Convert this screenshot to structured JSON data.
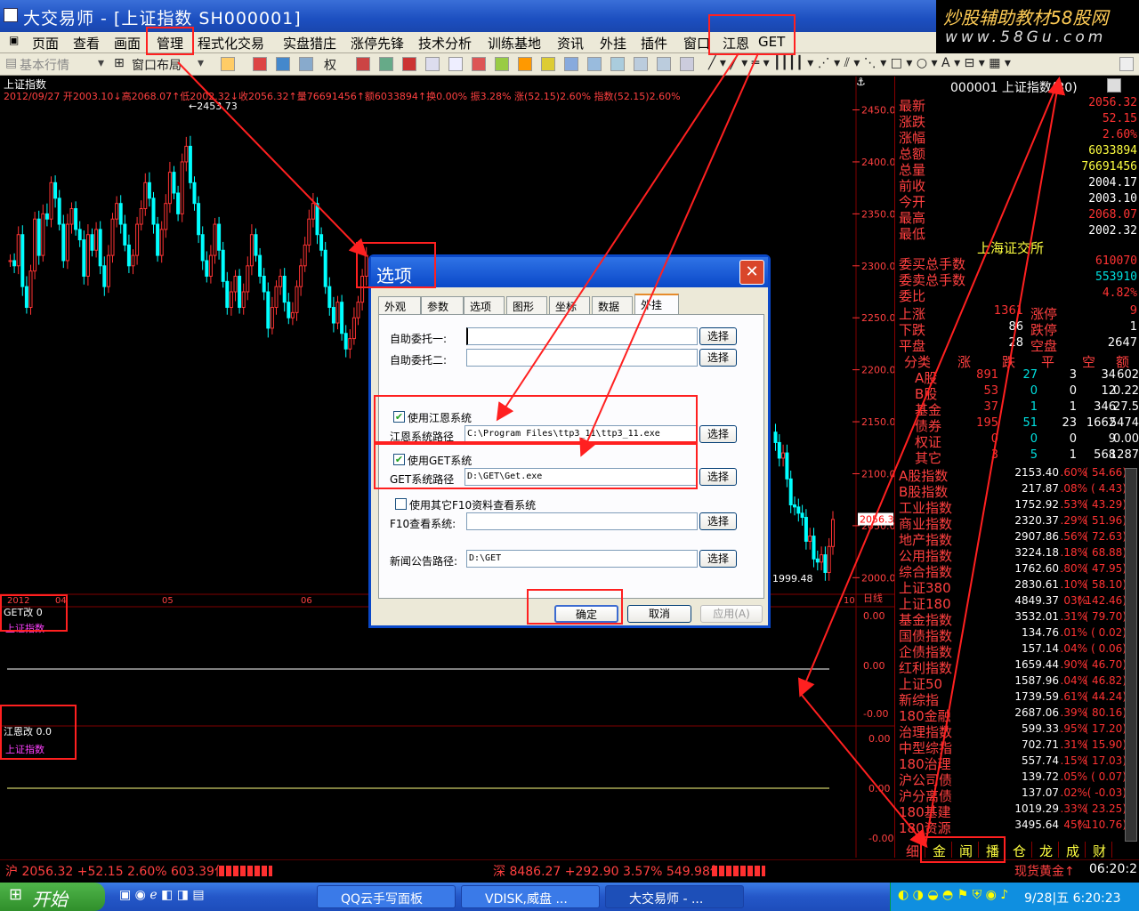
{
  "window": {
    "title": "大交易师 - [上证指数 SH000001]"
  },
  "watermark": {
    "line1": "炒股辅助教材58股网",
    "line2": "www.58Gu.com"
  },
  "menu": [
    "页面",
    "查看",
    "画面",
    "管理",
    "程式化交易",
    "实盘猎庄",
    "涨停先锋",
    "技术分析",
    "训练基地",
    "资讯",
    "外挂",
    "插件",
    "窗口",
    "江恩",
    "GET"
  ],
  "toolbar": {
    "market_label": "基本行情",
    "layout_label": "窗口布局",
    "rights_label": "权"
  },
  "chart_header": {
    "name": "上证指数",
    "info": "2012/09/27 开2003.10↓高2068.07↑低2002.32↓收2056.32↑量76691456↑额6033894↑换0.00% 振3.28% 涨(52.15)2.60% 指数(52.15)2.60%"
  },
  "chart_data": {
    "type": "candlestick",
    "title": "上证指数",
    "y_ticks": [
      2450.0,
      2400.0,
      2350.0,
      2300.0,
      2250.0,
      2200.0,
      2150.0,
      2100.0,
      2050.0,
      2000.0
    ],
    "ylim": [
      1990,
      2465
    ],
    "x_labels": [
      "2012",
      "04",
      "05",
      "06",
      "10"
    ],
    "annotations": {
      "high": "2453.73",
      "low": "1999.48",
      "current": "2056.3"
    },
    "segment_visible_left": {
      "start": 2320,
      "points": [
        -15,
        -20,
        10,
        -40,
        -60,
        -25,
        25,
        -10,
        30,
        25,
        60,
        45,
        20,
        -15,
        20,
        35,
        15,
        5,
        -30,
        10,
        -5,
        15,
        -20,
        -40,
        -10,
        25,
        40,
        20,
        0,
        -20,
        -10,
        20,
        35,
        60,
        45,
        20,
        -10,
        15,
        40,
        70,
        50,
        30,
        80,
        95,
        60,
        40,
        10,
        -15,
        -30,
        -10,
        20,
        -5,
        -35,
        -60,
        -45,
        -30,
        -60,
        -45,
        -20,
        10,
        -10,
        -30,
        -45,
        -80,
        -60,
        -40,
        -30,
        -55,
        -70,
        -65,
        -40,
        -20,
        0,
        25,
        40,
        10,
        -5,
        -40,
        -60,
        -75,
        -55,
        -85,
        -100,
        -90,
        -70,
        -55,
        -30,
        -10
      ]
    },
    "segment_visible_right": {
      "points": [
        2130,
        2115,
        2120,
        2095,
        2070,
        2068,
        2062,
        2058,
        2035,
        2040,
        2018,
        2015,
        2022,
        2005,
        2030,
        2056
      ]
    },
    "sub_panels": [
      {
        "name": "GET改",
        "value": "0",
        "series": "上证指数",
        "y_ticks": [
          "日线",
          "0.00",
          "0.00",
          "-0.00"
        ]
      },
      {
        "name": "江恩改",
        "value": "0.0",
        "series": "上证指数",
        "y_ticks": [
          "0.00",
          "0.00",
          "-0.00"
        ]
      }
    ]
  },
  "quote": {
    "code_title": "000001 上证指数(30)",
    "rows": [
      {
        "label": "最新",
        "value": "2056.32",
        "color": "red"
      },
      {
        "label": "涨跌",
        "value": "52.15",
        "color": "red"
      },
      {
        "label": "涨幅",
        "value": "2.60%",
        "color": "red"
      },
      {
        "label": "总额",
        "value": "6033894",
        "color": "yel"
      },
      {
        "label": "总量",
        "value": "76691456",
        "color": "yel"
      },
      {
        "label": "前收",
        "value": "2004.17",
        "color": "wht"
      },
      {
        "label": "今开",
        "value": "2003.10",
        "color": "wht"
      },
      {
        "label": "最高",
        "value": "2068.07",
        "color": "red"
      },
      {
        "label": "最低",
        "value": "2002.32",
        "color": "wht"
      }
    ],
    "exchange": "上海证交所",
    "exchange_rows": [
      {
        "label": "委买总手数",
        "value": "610070",
        "color": "red"
      },
      {
        "label": "委卖总手数",
        "value": "553910",
        "color": "green"
      },
      {
        "label": "委比",
        "value": "4.82%",
        "color": "red"
      }
    ],
    "updown": [
      {
        "l1": "上涨",
        "v1": "1361",
        "l2": "涨停",
        "v2": "9"
      },
      {
        "l1": "下跌",
        "v1": "86",
        "l2": "跌停",
        "v2": "1"
      },
      {
        "l1": "平盘",
        "v1": "28",
        "l2": "空盘",
        "v2": "2647"
      }
    ],
    "cat_headers": [
      "分类",
      "涨",
      "跌",
      "平",
      "空",
      "额"
    ],
    "cat_rows": [
      [
        "A股",
        "891",
        "27",
        "3",
        "34",
        "602"
      ],
      [
        "B股",
        "53",
        "0",
        "0",
        "12",
        "0.22"
      ],
      [
        "基金",
        "37",
        "1",
        "1",
        "346",
        "27.5"
      ],
      [
        "债券",
        "195",
        "51",
        "23",
        "1662",
        "5474"
      ],
      [
        "权证",
        "0",
        "0",
        "0",
        "9",
        "0.00"
      ],
      [
        "其它",
        "3",
        "5",
        "1",
        "568",
        "1287"
      ]
    ],
    "index_rows": [
      [
        "A股指数",
        "2153.40",
        ".60%",
        "54.66"
      ],
      [
        "B股指数",
        "217.87",
        ".08%",
        "4.43"
      ],
      [
        "工业指数",
        "1752.92",
        ".53%",
        "43.29"
      ],
      [
        "商业指数",
        "2320.37",
        ".29%",
        "51.96"
      ],
      [
        "地产指数",
        "2907.86",
        ".56%",
        "72.63"
      ],
      [
        "公用指数",
        "3224.18",
        ".18%",
        "68.88"
      ],
      [
        "综合指数",
        "1762.60",
        ".80%",
        "47.95"
      ],
      [
        "上证380",
        "2830.61",
        ".10%",
        "58.10"
      ],
      [
        "上证180",
        "4849.37",
        "03%",
        "142.46"
      ],
      [
        "基金指数",
        "3532.01",
        ".31%",
        "79.70"
      ],
      [
        "国债指数",
        "134.76",
        ".01%",
        "0.02"
      ],
      [
        "企债指数",
        "157.14",
        ".04%",
        "0.06"
      ],
      [
        "红利指数",
        "1659.44",
        ".90%",
        "46.70"
      ],
      [
        "上证50",
        "1587.96",
        ".04%",
        "46.82"
      ],
      [
        "新综指",
        "1739.59",
        ".61%",
        "44.24"
      ],
      [
        "180金融",
        "2687.06",
        ".39%",
        "80.16"
      ],
      [
        "治理指数",
        "599.33",
        ".95%",
        "17.20"
      ],
      [
        "中型综指",
        "702.71",
        ".31%",
        "15.90"
      ],
      [
        "180治理",
        "557.74",
        ".15%",
        "17.03"
      ],
      [
        "沪公司债",
        "139.72",
        ".05%",
        "0.07"
      ],
      [
        "沪分离债",
        "137.07",
        ".02%",
        "-0.03"
      ],
      [
        "180基建",
        "1019.29",
        ".33%",
        "23.25"
      ],
      [
        "180资源",
        "3495.64",
        "45%",
        "110.76"
      ]
    ],
    "bottom_tabs": [
      "细",
      "金",
      "闻",
      "播",
      "仓",
      "龙",
      "成",
      "财"
    ]
  },
  "status": {
    "sh": "沪 2056.32 +52.15 2.60% 603.39亿",
    "sz": "深 8486.27 +292.90 3.57% 549.98亿",
    "gold": "现货黄金↑",
    "time": "06:20:2"
  },
  "taskbar": {
    "start": "开始",
    "tasks": [
      "QQ云手写面板",
      "VDISK,威盘 ...",
      "大交易师 - ..."
    ],
    "clock": "9/28|五 6:20:23"
  },
  "dialog": {
    "title": "选项",
    "tabs": [
      "外观",
      "参数",
      "选项",
      "图形",
      "坐标",
      "数据",
      "外挂"
    ],
    "fields": {
      "auto1_label": "自助委托一:",
      "auto1_value": "",
      "auto2_label": "自助委托二:",
      "auto2_value": "",
      "gann_check": "使用江恩系统",
      "gann_path_label": "江恩系统路径",
      "gann_path": "C:\\Program Files\\ttp3_11\\ttp3_11.exe",
      "get_check": "使用GET系统",
      "get_path_label": "GET系统路径",
      "get_path": "D:\\GET\\Get.exe",
      "f10_check": "使用其它F10资料查看系统",
      "f10_label": "F10查看系统:",
      "f10_value": "",
      "news_label": "新闻公告路径:",
      "news_value": "D:\\GET"
    },
    "browse": "选择",
    "ok": "确定",
    "cancel": "取消",
    "apply": "应用(A)"
  },
  "colors": {
    "up": "#ff3333",
    "down": "#00ffff",
    "bg": "#000000",
    "grid": "#800000"
  }
}
